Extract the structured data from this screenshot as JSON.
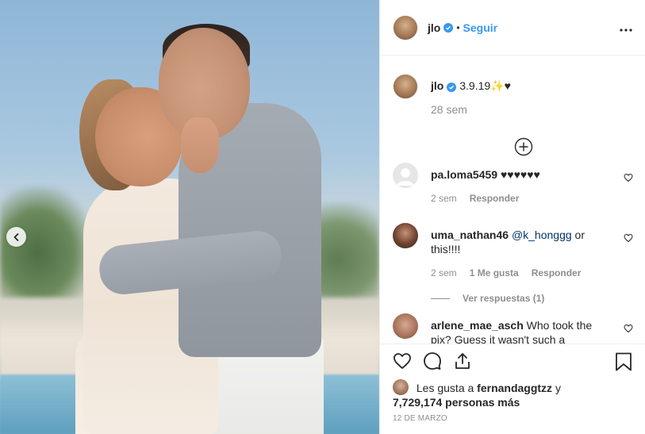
{
  "header": {
    "username": "jlo",
    "separator": "•",
    "follow_label": "Seguir"
  },
  "caption": {
    "username": "jlo",
    "text": "3.9.19✨♥",
    "time": "28 sem"
  },
  "comments": [
    {
      "username": "pa.loma5459",
      "text": "♥♥♥♥♥♥",
      "time": "2 sem",
      "reply_label": "Responder"
    },
    {
      "username": "uma_nathan46",
      "mention": "@k_honggg",
      "text": "or this!!!!",
      "time": "2 sem",
      "likes_label": "1 Me gusta",
      "reply_label": "Responder",
      "view_replies": "Ver respuestas (1)"
    },
    {
      "username": "arlene_mae_asch",
      "text": "Who took the pix? Guess it wasn't such a"
    }
  ],
  "likes": {
    "prefix": "Les gusta a",
    "first_user": "fernandaggtzz",
    "conjunction": "y",
    "count_text": "7,729,174 personas más"
  },
  "date": "12 DE MARZO",
  "colors": {
    "accent": "#3897f0",
    "text": "#262626",
    "muted": "#8e8e8e",
    "border": "#efefef"
  }
}
